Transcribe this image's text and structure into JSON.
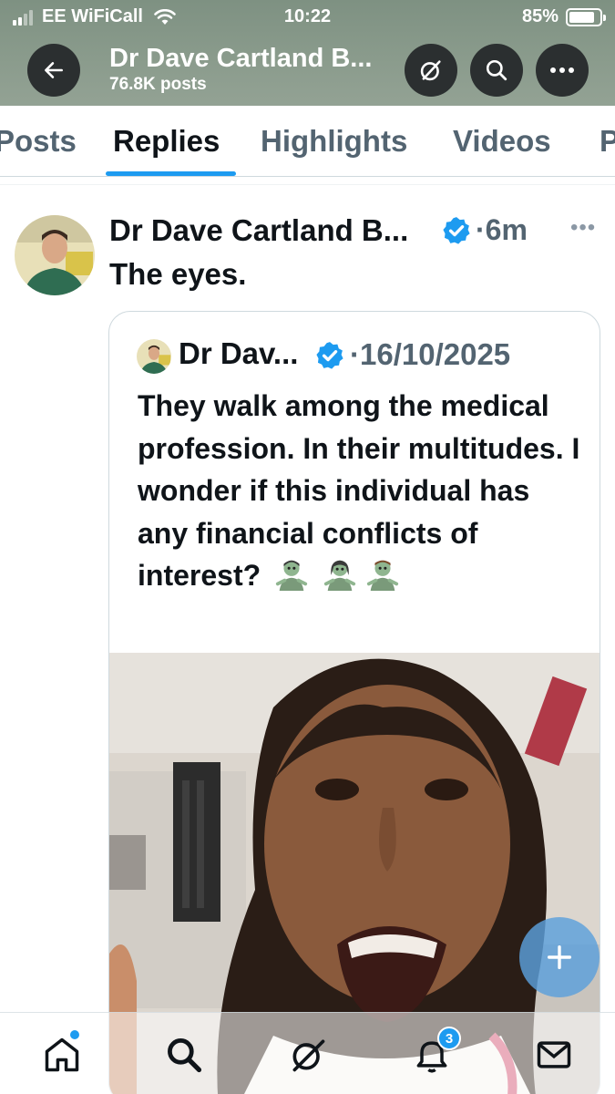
{
  "status_bar": {
    "carrier": "EE WiFiCall",
    "time": "10:22",
    "battery": "85%",
    "battery_level": 0.85
  },
  "header": {
    "title": "Dr Dave Cartland B...",
    "posts_count": "76.8K posts",
    "icons": [
      "back-arrow-icon",
      "grok-icon",
      "search-icon",
      "more-icon"
    ]
  },
  "tabs": [
    {
      "label": "Posts"
    },
    {
      "label": "Replies",
      "active": true
    },
    {
      "label": "Highlights"
    },
    {
      "label": "Videos"
    },
    {
      "label": "P"
    }
  ],
  "post": {
    "author": "Dr Dave Cartland B...",
    "time": "6m",
    "text": "The eyes.",
    "quote": {
      "author": "Dr Dav...",
      "date": "16/10/2025",
      "text": "They walk among the medical profession. In their multitudes. I wonder if this individual has any financial conflicts of interest?",
      "emojis": [
        "zombie-emoji",
        "zombie-emoji",
        "zombie-emoji"
      ]
    }
  },
  "bottom_nav": {
    "items": [
      "home-icon",
      "search-icon",
      "grok-icon",
      "notifications-icon",
      "messages-icon"
    ],
    "notification_count": "3"
  },
  "colors": {
    "accent": "#1d9bf0",
    "header_bg": "#8a9b8c",
    "text": "#0f1419",
    "muted": "#536471"
  }
}
